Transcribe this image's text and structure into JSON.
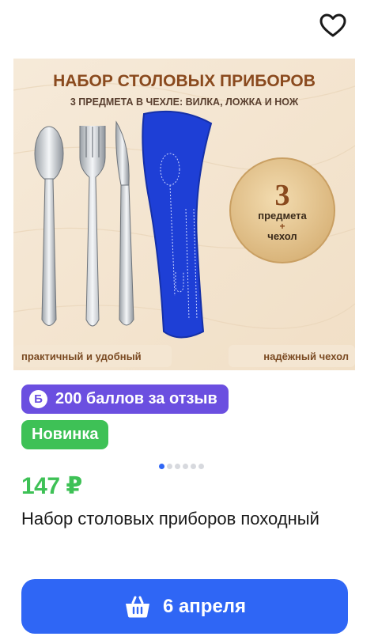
{
  "favorite": {
    "icon": "heart-outline-icon"
  },
  "image": {
    "title": "НАБОР СТОЛОВЫХ ПРИБОРОВ",
    "subtitle": "3 ПРЕДМЕТА В ЧЕХЛЕ: ВИЛКА, ЛОЖКА И НОЖ",
    "badge_number": "3",
    "badge_line1": "предмета",
    "badge_plus": "+",
    "badge_line2": "чехол",
    "caption_left": "практичный и удобный",
    "caption_right": "надёжный чехол"
  },
  "bonus": {
    "icon_letter": "Б",
    "text": "200 баллов за отзыв"
  },
  "new_label": "Новинка",
  "gallery": {
    "count": 6,
    "active": 0
  },
  "price": "147 ₽",
  "product_title": "Набор столовых приборов походный",
  "cart": {
    "label": "6 апреля",
    "icon": "basket-icon"
  },
  "colors": {
    "accent": "#2f66f5",
    "price": "#3ec156",
    "bonus": "#6b4fe0",
    "new": "#3ec156",
    "pouch": "#1e3fd6",
    "title_brown": "#8a4a1e"
  }
}
